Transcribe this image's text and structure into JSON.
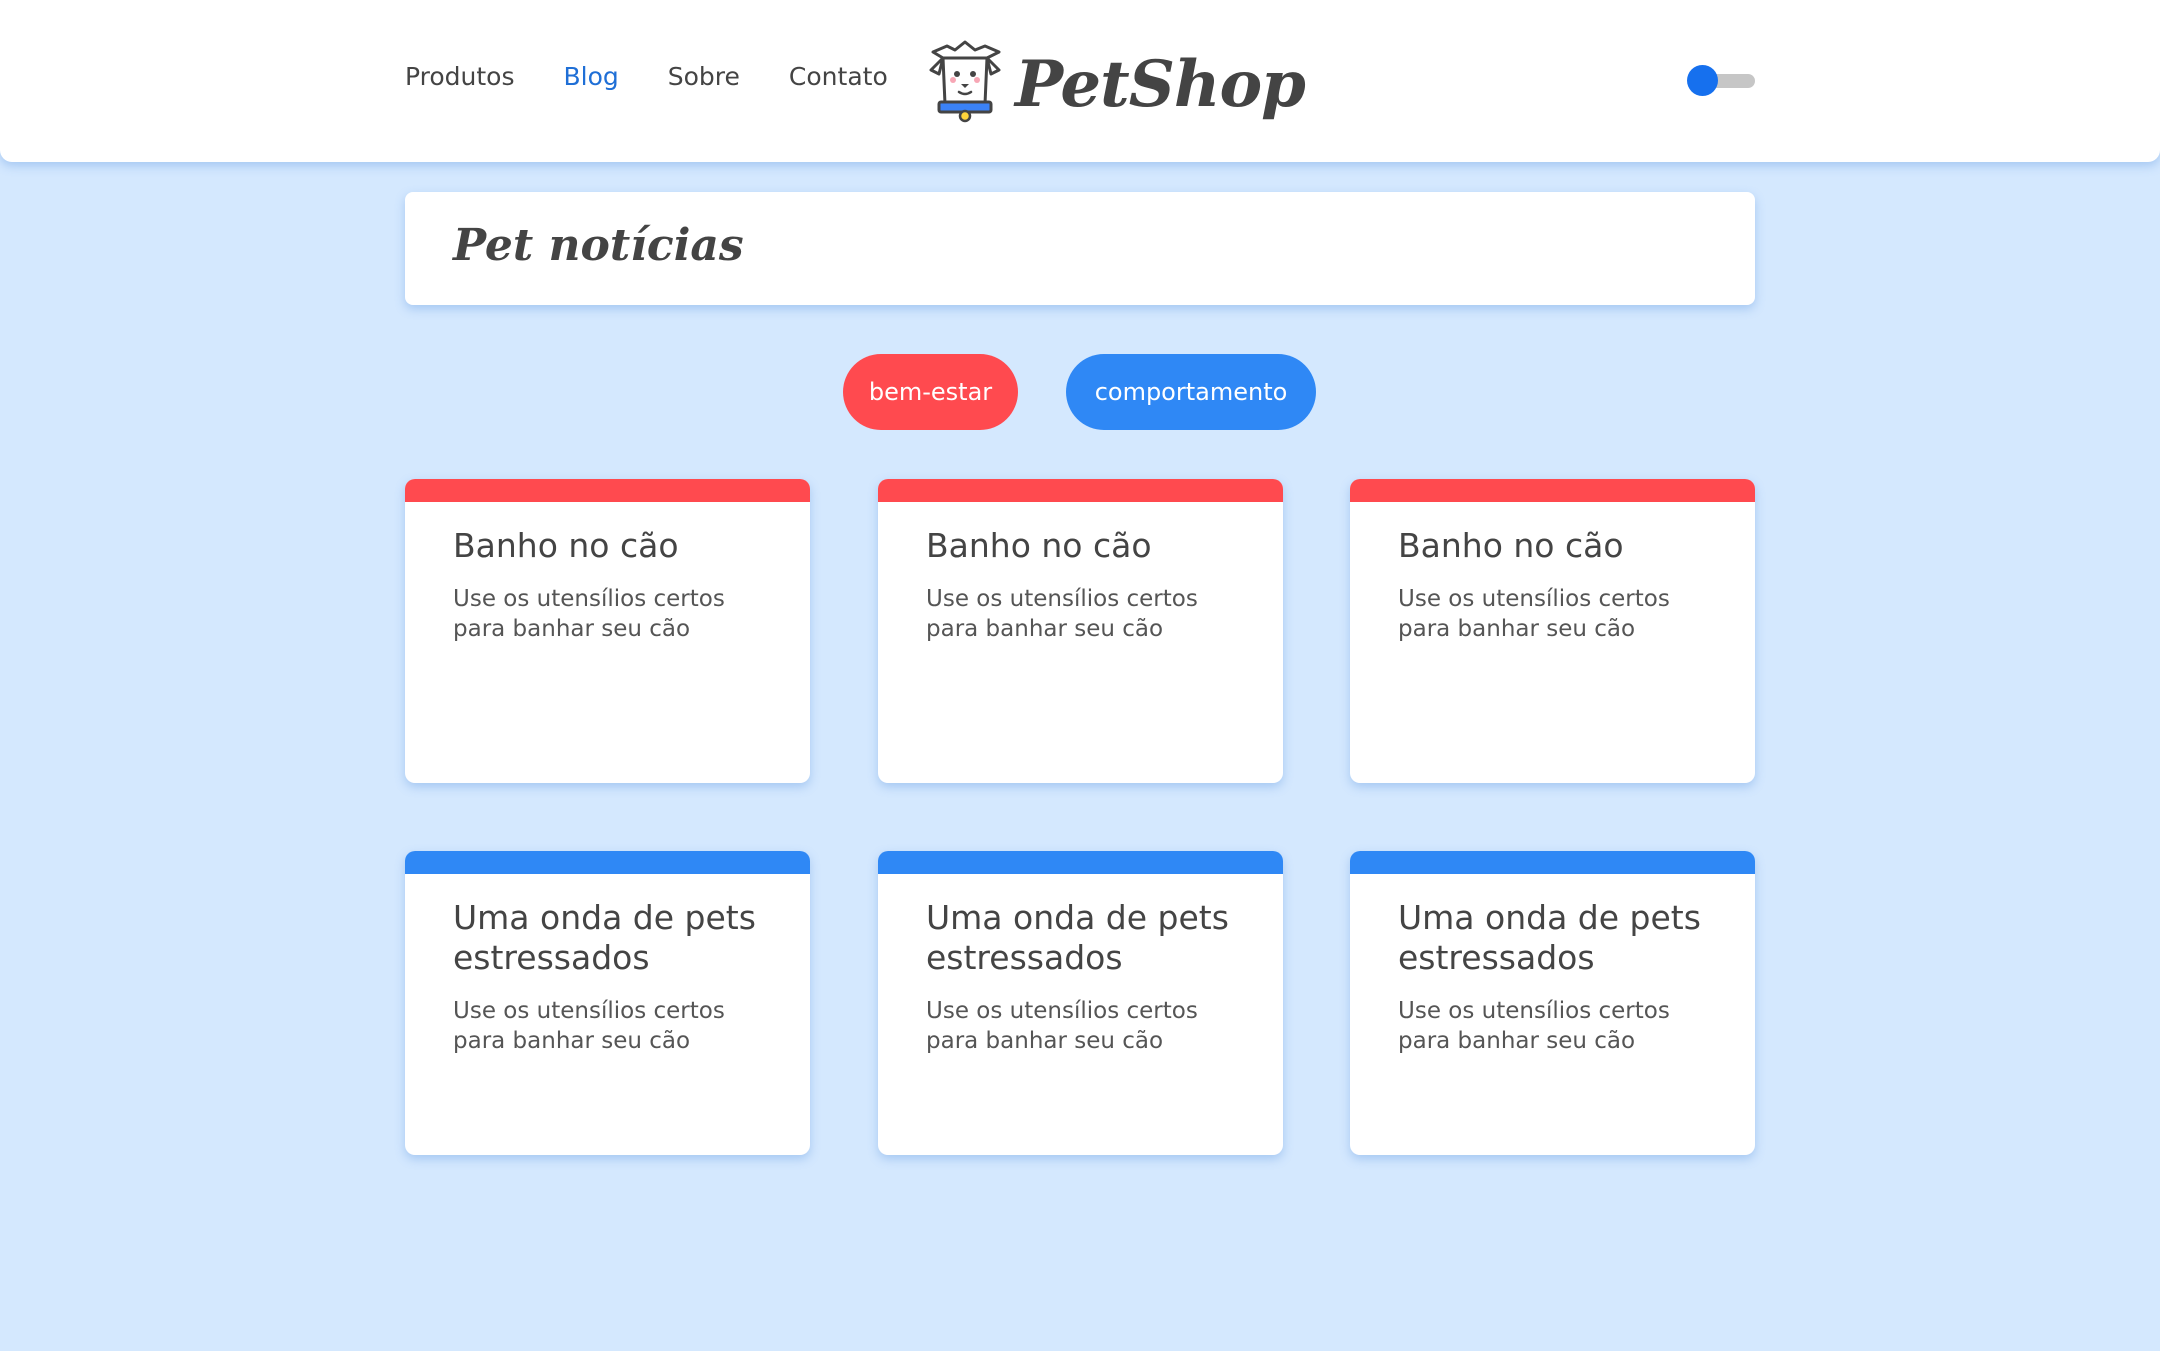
{
  "colors": {
    "background": "#d4e8fe",
    "accent_blue": "#2f88f5",
    "accent_red": "#ff4a4f",
    "active_link": "#1f6fd6",
    "toggle_knob": "#1670ee"
  },
  "header": {
    "nav": [
      "Produtos",
      "Blog",
      "Sobre",
      "Contato"
    ],
    "active_nav": "Blog",
    "logo_text": "PetShop",
    "logo_icon": "dog-chef-icon",
    "theme_toggle": {
      "state": "off"
    }
  },
  "main": {
    "page_title": "Pet notícias",
    "filters": [
      "bem-estar",
      "comportamento"
    ],
    "cards": [
      {
        "category": "bem-estar",
        "title": "Banho no cão",
        "description": "Use os utensílios certos para banhar seu cão"
      },
      {
        "category": "bem-estar",
        "title": "Banho no cão",
        "description": "Use os utensílios certos para banhar seu cão"
      },
      {
        "category": "bem-estar",
        "title": "Banho no cão",
        "description": "Use os utensílios certos para banhar seu cão"
      },
      {
        "category": "comportamento",
        "title": "Uma onda de pets estressados",
        "description": "Use os utensílios certos para banhar seu cão"
      },
      {
        "category": "comportamento",
        "title": "Uma onda de pets estressados",
        "description": "Use os utensílios certos para banhar seu cão"
      },
      {
        "category": "comportamento",
        "title": "Uma onda de pets estressados",
        "description": "Use os utensílios certos para banhar seu cão"
      }
    ]
  }
}
